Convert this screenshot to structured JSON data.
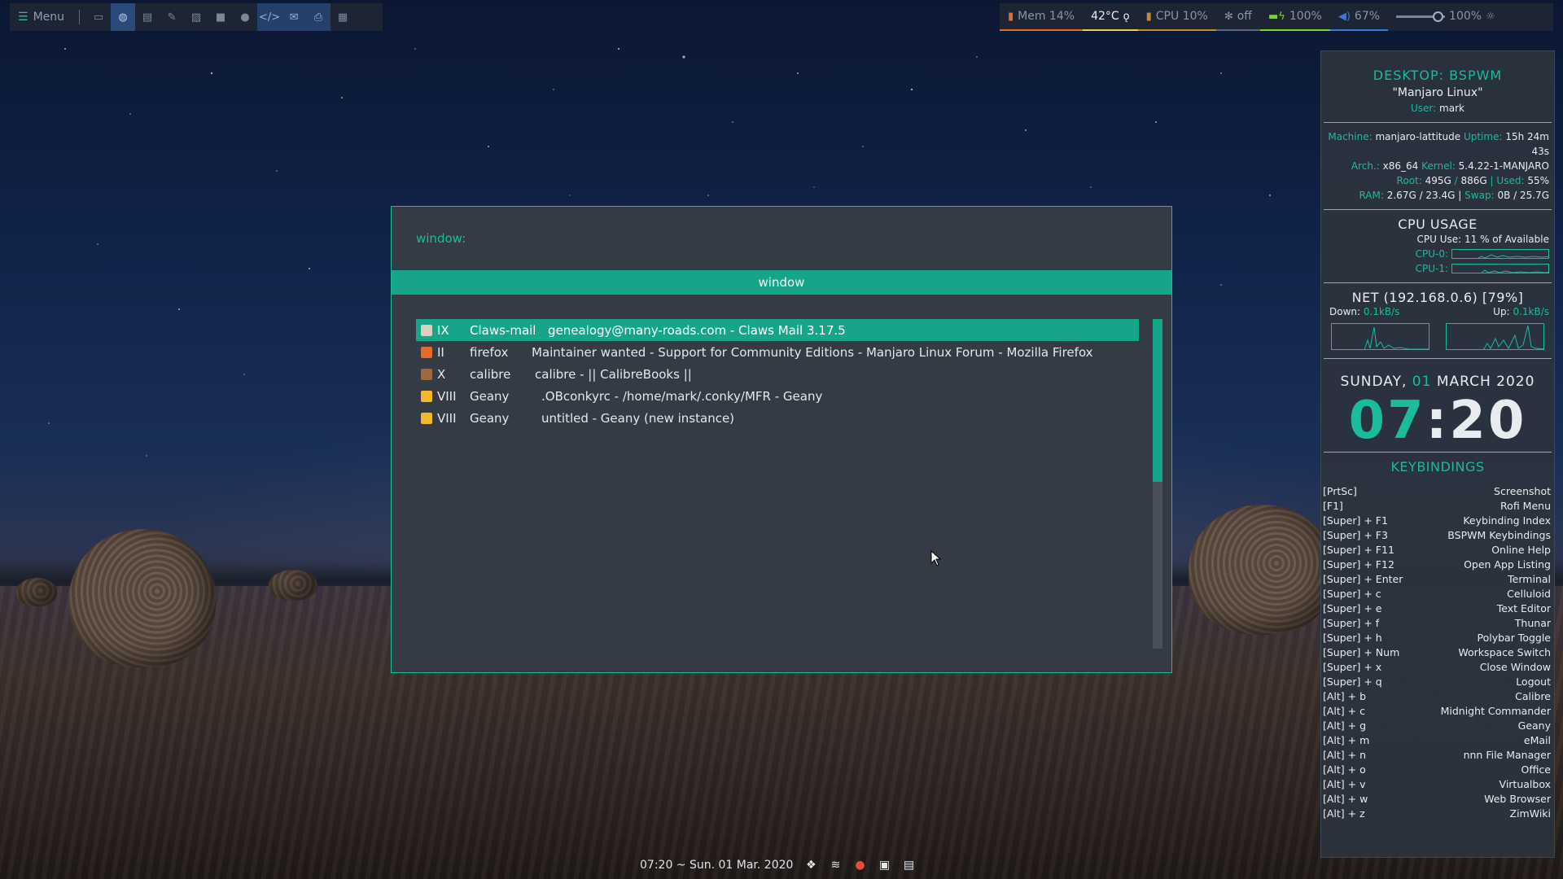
{
  "topbar": {
    "menu_label": "Menu",
    "launchers": [
      "terminal-icon",
      "globe-icon",
      "file-icon",
      "edit-icon",
      "image-icon",
      "video-icon",
      "mic-icon",
      "code-icon",
      "mail-icon",
      "printer-icon",
      "grid-icon"
    ],
    "modules": {
      "mem": "Mem 14%",
      "temp": "42°C",
      "cpu": "CPU 10%",
      "fan": "off",
      "battery": "100%",
      "volume": "67%",
      "brightness": "100%"
    }
  },
  "rofi": {
    "prompt": "window:",
    "mode": "window",
    "rows": [
      {
        "ws": "IX",
        "cls": "Claws-mail",
        "title": "genealogy@many-roads.com - Claws Mail 3.17.5",
        "selected": true,
        "color": "#d8d0c0"
      },
      {
        "ws": "II",
        "cls": "firefox",
        "title": "Maintainer wanted - Support for Community Editions - Manjaro Linux Forum - Mozilla Firefox",
        "selected": false,
        "color": "#e66a2c"
      },
      {
        "ws": "X",
        "cls": "calibre",
        "title": "calibre - || CalibreBooks ||",
        "selected": false,
        "color": "#9c6b3c"
      },
      {
        "ws": "VIII",
        "cls": "Geany",
        "title": ".OBconkyrc - /home/mark/.conky/MFR - Geany",
        "selected": false,
        "color": "#f2b72a"
      },
      {
        "ws": "VIII",
        "cls": "Geany",
        "title": "untitled - Geany (new instance)",
        "selected": false,
        "color": "#f2b72a"
      }
    ]
  },
  "conky": {
    "desktop_title": "DESKTOP: BSPWM",
    "distro": "\"Manjaro Linux\"",
    "user_label": "User:",
    "user": "mark",
    "machine_label": "Machine:",
    "machine": "manjaro-lattitude",
    "uptime_label": "Uptime:",
    "uptime": "15h 24m 43s",
    "arch_label": "Arch.:",
    "arch": "x86_64",
    "kernel_label": "Kernel:",
    "kernel": "5.4.22-1-MANJARO",
    "root_label": "Root:",
    "root_free": "495G",
    "root_total": "886G",
    "used_label": "Used:",
    "used": "55%",
    "ram_label": "RAM:",
    "ram": "2.67G / 23.4G",
    "swap_label": "Swap:",
    "swap": "0B / 25.7G",
    "cpu_title": "CPU USAGE",
    "cpu_use": "CPU Use: 11 % of Available",
    "cpu0_label": "CPU-0:",
    "cpu1_label": "CPU-1:",
    "net_title": "NET (192.168.0.6) [79%]",
    "down_label": "Down:",
    "down": "0.1kB/s",
    "up_label": "Up:",
    "up": "0.1kB/s",
    "date_day": "SUNDAY, ",
    "date_num": "01",
    "date_rest": " MARCH 2020",
    "clock_h": "07",
    "clock_sep": ":",
    "clock_m": "20",
    "keys_title": "KEYBINDINGS",
    "keybindings": [
      [
        "[PrtSc]",
        "Screenshot"
      ],
      [
        "[F1]",
        "Rofi Menu"
      ],
      [
        "[Super] + F1",
        "Keybinding Index"
      ],
      [
        "[Super] + F3",
        "BSPWM Keybindings"
      ],
      [
        "[Super] + F11",
        "Online Help"
      ],
      [
        "[Super] + F12",
        "Open App Listing"
      ],
      [
        "[Super] + Enter",
        "Terminal"
      ],
      [
        "[Super] + c",
        "Celluloid"
      ],
      [
        "[Super] + e",
        "Text Editor"
      ],
      [
        "[Super] + f",
        "Thunar"
      ],
      [
        "[Super] + h",
        "Polybar Toggle"
      ],
      [
        "[Super] + Num",
        "Workspace Switch"
      ],
      [
        "[Super] + x",
        "Close Window"
      ],
      [
        "[Super] + q",
        "Logout"
      ],
      [
        "[Alt] + b",
        "Calibre"
      ],
      [
        "[Alt] + c",
        "Midnight Commander"
      ],
      [
        "[Alt] + g",
        "Geany"
      ],
      [
        "[Alt] + m",
        "eMail"
      ],
      [
        "[Alt] + n",
        "nnn File Manager"
      ],
      [
        "[Alt] + o",
        "Office"
      ],
      [
        "[Alt] + v",
        "Virtualbox"
      ],
      [
        "[Alt] + w",
        "Web Browser"
      ],
      [
        "[Alt] + z",
        "ZimWiki"
      ]
    ]
  },
  "bottombar": {
    "datetime": "07:20 ~ Sun. 01 Mar. 2020",
    "tray_icons": [
      "dropbox-icon",
      "wifi-icon",
      "chat-icon",
      "drive-icon",
      "clipboard-icon"
    ]
  },
  "colors": {
    "accent": "#1abc9c",
    "selection": "#16a589",
    "panel": "#343b44"
  }
}
